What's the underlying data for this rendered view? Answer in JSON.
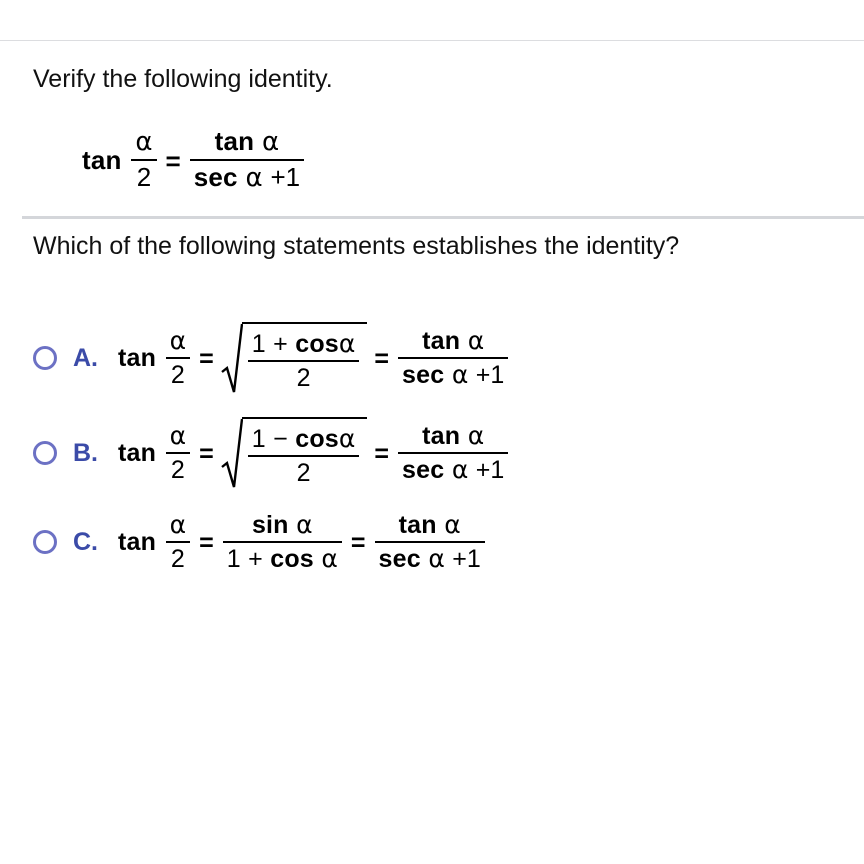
{
  "page": {
    "background": "#ffffff",
    "divider_color": "#dcdde0",
    "divider_color_secondary": "#d4d6da",
    "accent_letter_color": "#3b4ba8",
    "radio_ring_color": "#6c71c4"
  },
  "prompt": {
    "instruction": "Verify the following identity.",
    "question": "Which of the following statements establishes the identity?"
  },
  "identity": {
    "lhs_fn": "tan",
    "lhs_num": "α",
    "lhs_den": "2",
    "equals": "=",
    "rhs_num_fn": "tan",
    "rhs_num_arg": "α",
    "rhs_den_fn": "sec",
    "rhs_den_arg": "α",
    "rhs_den_plus": "+",
    "rhs_den_one": "1"
  },
  "options": [
    {
      "id": "A",
      "letter": "A.",
      "selected": false,
      "lhs_fn": "tan",
      "lhs_num": "α",
      "lhs_den": "2",
      "equals1": "=",
      "middle_type": "sqrt",
      "radicand_num_one": "1",
      "radicand_num_sign": "+",
      "radicand_num_fn": "cos",
      "radicand_num_arg": "α",
      "radicand_den": "2",
      "equals2": "=",
      "rhs_num_fn": "tan",
      "rhs_num_arg": "α",
      "rhs_den_fn": "sec",
      "rhs_den_arg": "α",
      "rhs_den_plus": "+",
      "rhs_den_one": "1"
    },
    {
      "id": "B",
      "letter": "B.",
      "selected": false,
      "lhs_fn": "tan",
      "lhs_num": "α",
      "lhs_den": "2",
      "equals1": "=",
      "middle_type": "sqrt",
      "radicand_num_one": "1",
      "radicand_num_sign": "−",
      "radicand_num_fn": "cos",
      "radicand_num_arg": "α",
      "radicand_den": "2",
      "equals2": "=",
      "rhs_num_fn": "tan",
      "rhs_num_arg": "α",
      "rhs_den_fn": "sec",
      "rhs_den_arg": "α",
      "rhs_den_plus": "+",
      "rhs_den_one": "1"
    },
    {
      "id": "C",
      "letter": "C.",
      "selected": false,
      "lhs_fn": "tan",
      "lhs_num": "α",
      "lhs_den": "2",
      "equals1": "=",
      "middle_type": "fraction",
      "mid_num_fn": "sin",
      "mid_num_arg": "α",
      "mid_den_one": "1",
      "mid_den_sign": "+",
      "mid_den_fn": "cos",
      "mid_den_arg": "α",
      "equals2": "=",
      "rhs_num_fn": "tan",
      "rhs_num_arg": "α",
      "rhs_den_fn": "sec",
      "rhs_den_arg": "α",
      "rhs_den_plus": "+",
      "rhs_den_one": "1"
    }
  ]
}
